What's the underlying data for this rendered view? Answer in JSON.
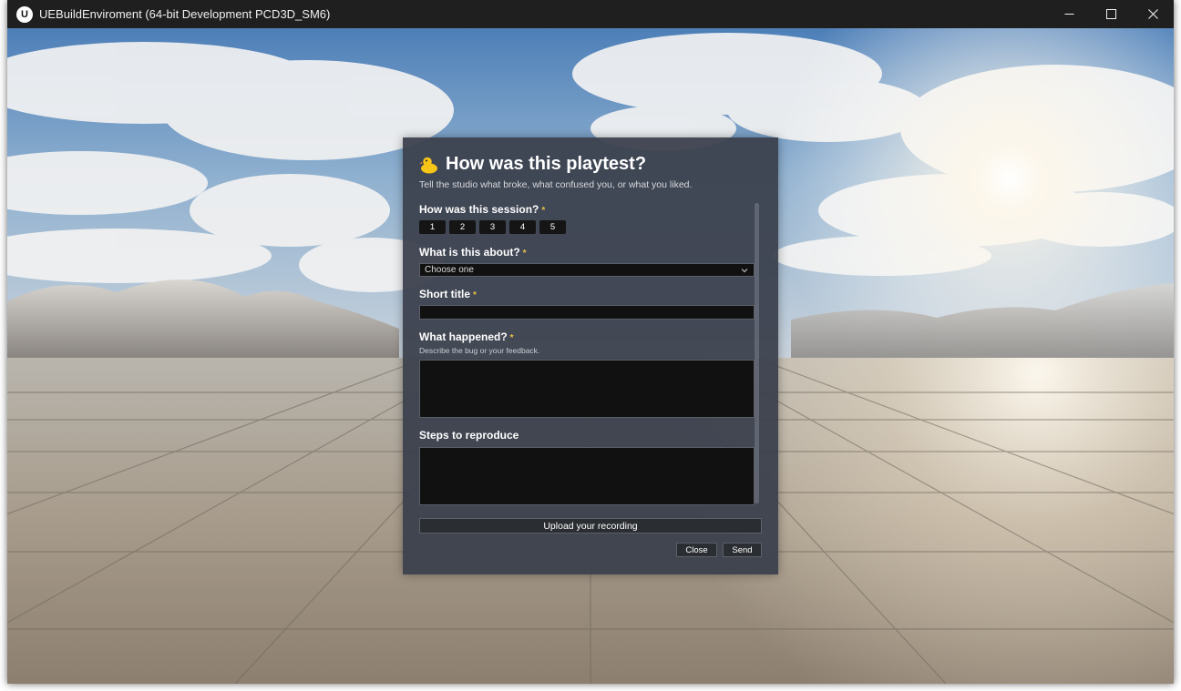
{
  "window": {
    "title": "UEBuildEnviroment (64-bit Development PCD3D_SM6)",
    "logo_letter": "U",
    "minimize_label": "─",
    "maximize_label": "☐",
    "close_label": "✕"
  },
  "dialog": {
    "title": "How was this playtest?",
    "subtitle": "Tell the studio what broke, what confused you, or what you liked.",
    "required_marker": "*",
    "rating": {
      "label": "How was this session?",
      "options": [
        "1",
        "2",
        "3",
        "4",
        "5"
      ]
    },
    "category": {
      "label": "What is this about?",
      "selected": "Choose one"
    },
    "short_title": {
      "label": "Short title",
      "value": ""
    },
    "what_happened": {
      "label": "What happened?",
      "hint": "Describe the bug or your feedback.",
      "value": ""
    },
    "steps": {
      "label": "Steps to reproduce",
      "value": ""
    },
    "upload_label": "Upload your recording",
    "close_label": "Close",
    "send_label": "Send"
  },
  "icons": {
    "dialog_icon": "duck-icon",
    "dropdown_icon": "chevron-down-icon"
  },
  "colors": {
    "required": "#e8c04a",
    "dialog_bg": "#3a404c",
    "field_bg": "#111111"
  }
}
